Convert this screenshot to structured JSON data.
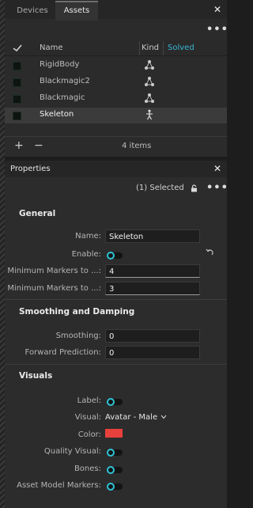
{
  "assets": {
    "tabs": [
      {
        "label": "Devices"
      },
      {
        "label": "Assets"
      }
    ],
    "columns": {
      "name": "Name",
      "kind": "Kind",
      "solved": "Solved"
    },
    "rows": [
      {
        "name": "RigidBody",
        "kind": "rigid-body-icon"
      },
      {
        "name": "Blackmagic2",
        "kind": "rigid-body-icon"
      },
      {
        "name": "Blackmagic",
        "kind": "rigid-body-icon"
      },
      {
        "name": "Skeleton",
        "kind": "skeleton-icon"
      }
    ],
    "item_count": "4 items",
    "add_symbol": "+",
    "remove_symbol": "−",
    "close_symbol": "✕",
    "more_symbol": "•••"
  },
  "properties": {
    "title": "Properties",
    "selected": "(1) Selected",
    "close_symbol": "✕",
    "more_symbol": "•••",
    "general": {
      "header": "General",
      "name_label": "Name:",
      "name_value": "Skeleton",
      "enable_label": "Enable:",
      "min_markers_1_label": "Minimum Markers to ...:",
      "min_markers_1_value": "4",
      "min_markers_2_label": "Minimum Markers to ...:",
      "min_markers_2_value": "3"
    },
    "smoothing": {
      "header": "Smoothing and Damping",
      "smoothing_label": "Smoothing:",
      "smoothing_value": "0",
      "forward_label": "Forward Prediction:",
      "forward_value": "0"
    },
    "visuals": {
      "header": "Visuals",
      "label_label": "Label:",
      "visual_label": "Visual:",
      "visual_value": "Avatar - Male",
      "color_label": "Color:",
      "quality_label": "Quality Visual:",
      "bones_label": "Bones:",
      "asset_markers_label": "Asset Model Markers:"
    }
  },
  "colors": {
    "accent": "#2ec4d6",
    "asset_color": "#e8403c",
    "solved_header": "#37b7d6"
  }
}
